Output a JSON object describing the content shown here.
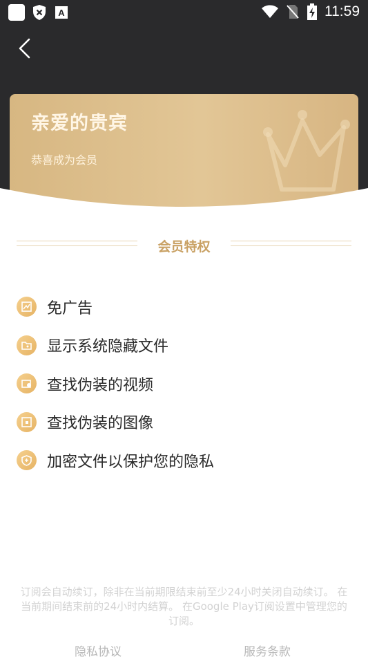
{
  "status_bar": {
    "time": "11:59"
  },
  "card": {
    "title": "亲爱的贵宾",
    "subtitle": "恭喜成为会员"
  },
  "section": {
    "title": "会员特权"
  },
  "features": [
    {
      "label": "免广告",
      "icon": "ad-free-icon"
    },
    {
      "label": "显示系统隐藏文件",
      "icon": "folder-icon"
    },
    {
      "label": "查找伪装的视频",
      "icon": "video-icon"
    },
    {
      "label": "查找伪装的图像",
      "icon": "image-icon"
    },
    {
      "label": "加密文件以保护您的隐私",
      "icon": "shield-icon"
    }
  ],
  "notice": "订阅会自动续订，除非在当前期限结束前至少24小时关闭自动续订。 在当前期间结束前的24小时内结算。 在Google Play订阅设置中管理您的订阅。",
  "links": {
    "privacy": "隐私协议",
    "terms": "服务条款"
  },
  "colors": {
    "header_bg": "#2a2a2c",
    "gold": "#d7b782",
    "accent_text": "#c9a164"
  }
}
